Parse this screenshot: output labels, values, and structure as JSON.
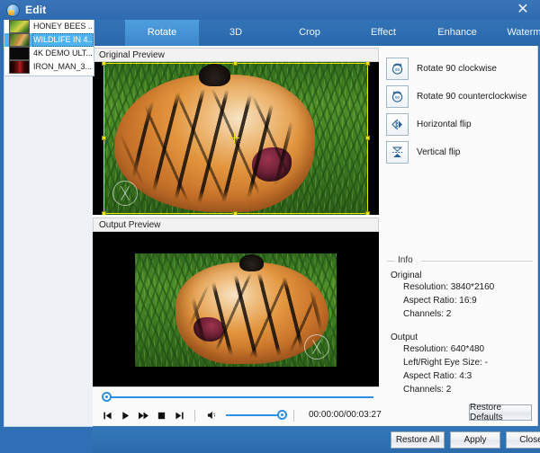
{
  "window": {
    "title": "Edit",
    "app_icon": "globe-icon",
    "close_label": "✕"
  },
  "file_list": {
    "items": [
      {
        "name": "HONEY BEES ...",
        "thumb": "honey-bees-thumb",
        "selected": false
      },
      {
        "name": "WILDLIFE IN 4...",
        "thumb": "wildlife-thumb",
        "selected": true
      },
      {
        "name": "4K DEMO ULT...",
        "thumb": "4k-demo-thumb",
        "selected": false
      },
      {
        "name": "IRON_MAN_3...",
        "thumb": "iron-man-thumb",
        "selected": false
      }
    ]
  },
  "tabs": {
    "items": [
      {
        "label": "Rotate",
        "active": true
      },
      {
        "label": "3D",
        "active": false
      },
      {
        "label": "Crop",
        "active": false
      },
      {
        "label": "Effect",
        "active": false
      },
      {
        "label": "Enhance",
        "active": false
      },
      {
        "label": "Watermark",
        "active": false
      }
    ]
  },
  "previews": {
    "original_label": "Original Preview",
    "output_label": "Output Preview"
  },
  "rotate_tools": {
    "items": [
      {
        "label": "Rotate 90 clockwise",
        "icon": "rotate-cw-90-icon"
      },
      {
        "label": "Rotate 90 counterclockwise",
        "icon": "rotate-ccw-90-icon"
      },
      {
        "label": "Horizontal flip",
        "icon": "horizontal-flip-icon"
      },
      {
        "label": "Vertical flip",
        "icon": "vertical-flip-icon"
      }
    ]
  },
  "info": {
    "legend": "Info",
    "original_heading": "Original",
    "original_items": [
      "Resolution: 3840*2160",
      "Aspect Ratio: 16:9",
      "Channels: 2"
    ],
    "output_heading": "Output",
    "output_items": [
      "Resolution: 640*480",
      "Left/Right Eye Size: -",
      "Aspect Ratio: 4:3",
      "Channels: 2"
    ]
  },
  "player": {
    "seek_position_pct": 0,
    "volume_pct": 100,
    "timecode": "00:00:00/00:03:27",
    "buttons": [
      {
        "name": "previous",
        "glyph": "⏮"
      },
      {
        "name": "play",
        "glyph": "▶"
      },
      {
        "name": "fast-forward",
        "glyph": "▶▶"
      },
      {
        "name": "stop",
        "glyph": "■"
      },
      {
        "name": "next",
        "glyph": "⏭"
      }
    ]
  },
  "actions": {
    "restore_defaults": "Restore Defaults",
    "restore_all": "Restore All",
    "apply": "Apply",
    "close": "Close"
  },
  "colors": {
    "titlebar": "#2f6bb0",
    "tabbar": "#2a68ac",
    "tab_active": "#4f9ede",
    "selection": "#4eb3f0",
    "slider": "#2f8fe0",
    "crop_frame": "#e9e900",
    "panel_bg": "#fbfbfb"
  }
}
